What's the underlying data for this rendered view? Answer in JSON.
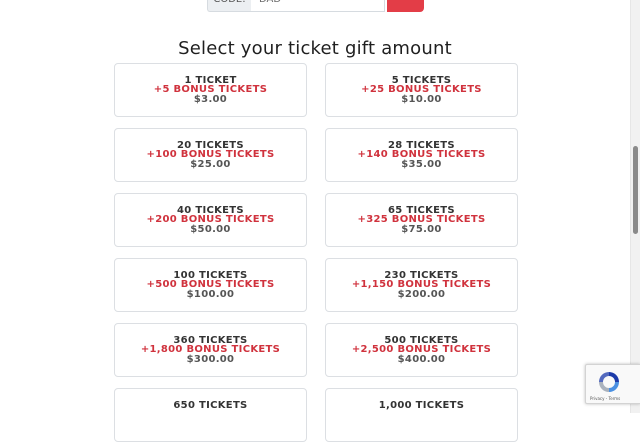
{
  "code_row": {
    "label": "CODE:",
    "value": "DAD"
  },
  "section_title": "Select your ticket gift amount",
  "options": [
    {
      "tickets": "1 TICKET",
      "bonus": "+5 BONUS TICKETS",
      "price": "$3.00"
    },
    {
      "tickets": "5 TICKETS",
      "bonus": "+25 BONUS TICKETS",
      "price": "$10.00"
    },
    {
      "tickets": "20 TICKETS",
      "bonus": "+100 BONUS TICKETS",
      "price": "$25.00"
    },
    {
      "tickets": "28 TICKETS",
      "bonus": "+140 BONUS TICKETS",
      "price": "$35.00"
    },
    {
      "tickets": "40 TICKETS",
      "bonus": "+200 BONUS TICKETS",
      "price": "$50.00"
    },
    {
      "tickets": "65 TICKETS",
      "bonus": "+325 BONUS TICKETS",
      "price": "$75.00"
    },
    {
      "tickets": "100 TICKETS",
      "bonus": "+500 BONUS TICKETS",
      "price": "$100.00"
    },
    {
      "tickets": "230 TICKETS",
      "bonus": "+1,150 BONUS TICKETS",
      "price": "$200.00"
    },
    {
      "tickets": "360 TICKETS",
      "bonus": "+1,800 BONUS TICKETS",
      "price": "$300.00"
    },
    {
      "tickets": "500 TICKETS",
      "bonus": "+2,500 BONUS TICKETS",
      "price": "$400.00"
    },
    {
      "tickets": "650 TICKETS",
      "bonus": "",
      "price": ""
    },
    {
      "tickets": "1,000 TICKETS",
      "bonus": "",
      "price": ""
    }
  ],
  "recaptcha": {
    "links": "Privacy - Terms",
    "icon": "recaptcha-icon"
  },
  "colors": {
    "accent": "#e33d47",
    "bonus": "#d0323d",
    "border": "#dcdfe3"
  }
}
